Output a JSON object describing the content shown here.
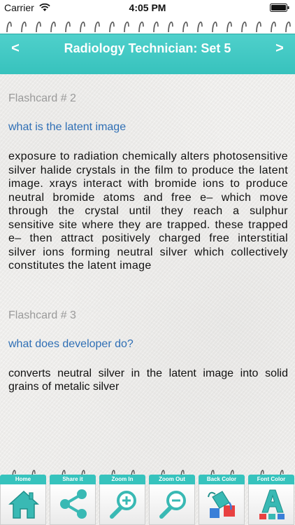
{
  "status_bar": {
    "carrier": "Carrier",
    "time": "4:05 PM",
    "icons": [
      "wifi-icon",
      "battery-icon"
    ]
  },
  "header": {
    "title": "Radiology Technician: Set 5",
    "prev_label": "<",
    "next_label": ">",
    "accent_color": "#3cc6c1"
  },
  "cards": [
    {
      "label": "Flashcard # 2",
      "question": "what is the latent image",
      "answer": "exposure to radiation chemically alters photosensitive silver halide crystals in the film to produce the latent image. xrays interact with bromide ions to produce neutral bromide atoms and free e– which move through the crystal until they reach a sulphur sensitive site where they are trapped. these trapped e– then attract positively charged free interstitial silver ions forming neutral silver which collectively constitutes the latent image"
    },
    {
      "label": "Flashcard # 3",
      "question": "what does developer do?",
      "answer": "converts neutral silver in the latent image into solid grains of metalic silver"
    }
  ],
  "toolbar": {
    "items": [
      {
        "label": "Home",
        "icon": "home-icon"
      },
      {
        "label": "Share it",
        "icon": "share-icon"
      },
      {
        "label": "Zoom In",
        "icon": "zoom-in-icon"
      },
      {
        "label": "Zoom Out",
        "icon": "zoom-out-icon"
      },
      {
        "label": "Back Color",
        "icon": "paint-bucket-icon"
      },
      {
        "label": "Font Color",
        "icon": "font-color-icon"
      }
    ]
  },
  "colors": {
    "question": "#2f6fb5",
    "label": "#9a9a9a",
    "toolbar_tab": "#36c3bd"
  }
}
